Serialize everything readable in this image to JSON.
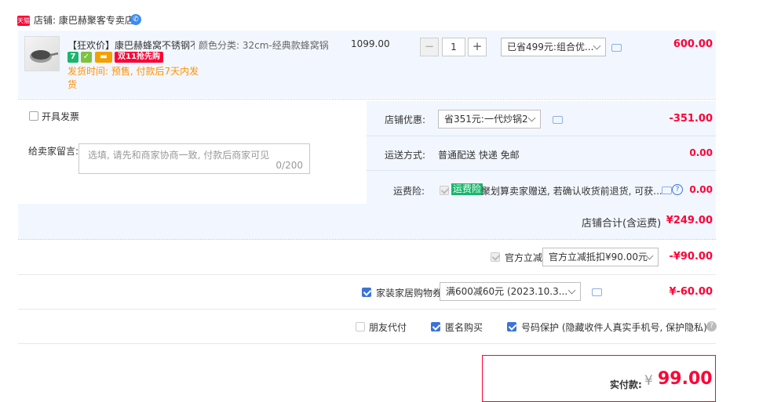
{
  "shop": {
    "badge": "天猫",
    "label": "店铺: 康巴赫聚客专卖店",
    "chat_icon": "wangwang-chat-icon"
  },
  "item": {
    "title": "【狂欢价】康巴赫蜂窝不锈钢不...",
    "spec": "颜色分类: 32cm-经典款蜂窝锅",
    "unit_price": "1099.00",
    "quantity": "1",
    "promo_select": "已省499元:组合优...",
    "subtotal": "600.00",
    "double11": "双11抢先购",
    "ship_time_line1": "发货时间: 预售, 付款后7天内发",
    "ship_time_line2": "货"
  },
  "invoice": {
    "label": "开具发票"
  },
  "message": {
    "label": "给卖家留言:",
    "placeholder": "选填, 请先和商家协商一致, 付款后商家可见",
    "counter": "0/200"
  },
  "shop_discount": {
    "label": "店铺优惠:",
    "selected": "省351元:一代炒锅2",
    "amount": "-351.00"
  },
  "shipping": {
    "label": "运送方式:",
    "method": "普通配送 快递 免邮",
    "amount": "0.00"
  },
  "insurance": {
    "label": "运费险:",
    "tag": "运费险",
    "text": "聚划算卖家赠送, 若确认收货前退货, 可获...",
    "amount": "0.00"
  },
  "shop_total": {
    "label": "店铺合计(含运费)",
    "amount": "¥249.00"
  },
  "official": {
    "label": "官方立减",
    "selected": "官方立减抵扣¥90.00元",
    "amount": "-¥90.00"
  },
  "coupon": {
    "label": "家装家居购物券",
    "selected": "满600减60元 (2023.10.3...",
    "amount": "¥-60.00"
  },
  "options": {
    "friend_pay": "朋友代付",
    "anonymous": "匿名购买",
    "privacy": "号码保护 (隐藏收件人真实手机号, 保护隐私)"
  },
  "payment": {
    "label": "实付款:",
    "currency": "¥",
    "amount": "99.00"
  },
  "colors": {
    "accent_red": "#ff0036",
    "panel_bg": "#f2f7ff",
    "checkbox_blue": "#3b74d8",
    "brand_orange": "#ff9000"
  }
}
